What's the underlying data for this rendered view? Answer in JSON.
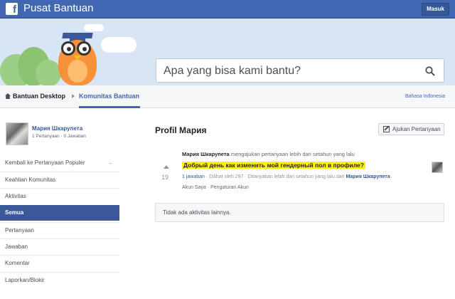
{
  "header": {
    "brand": "Pusat Bantuan",
    "login_label": "Masuk"
  },
  "search": {
    "placeholder": "Apa yang bisa kami bantu?"
  },
  "nav": {
    "home": "Bantuan Desktop",
    "community": "Komunitas Bantuan",
    "language": "Bahasa Indonesia"
  },
  "profile": {
    "name": "Мария Шкарупета",
    "questions": "1 Pertanyaan",
    "separator": "·",
    "answers": "0 Jawaban"
  },
  "sidebar": {
    "items": [
      {
        "label": "Kembali ke Pertanyaan Populer"
      },
      {
        "label": "Keahlian Komunitas"
      },
      {
        "label": "Aktivitas"
      },
      {
        "label": "Semua"
      },
      {
        "label": "Pertanyaan"
      },
      {
        "label": "Jawaban"
      },
      {
        "label": "Komentar"
      },
      {
        "label": "Laporkan/Blokir"
      }
    ]
  },
  "main": {
    "title": "Profil Мария",
    "ask_button": "Ajukan Pertanyaan",
    "activity_user": "Мария Шкарупета",
    "activity_text": "mengajukan pertanyaan lebih dari setahun yang lalu",
    "question": {
      "votes": "19",
      "title": "Добрый день как изменить мой гендерный пол в профиле?",
      "answers": "1 jawaban",
      "views": "Dilihat oleh 297",
      "asked": "Ditanyakan lebih dari setahun yang lalu dari",
      "asker": "Мария Шкарупета",
      "sep": "·",
      "tag1": "Akun Saya",
      "tag2": "Pengaturan Akun"
    },
    "empty_text": "Tidak ada aktivitas lainnya."
  },
  "colors": {
    "brand": "#4267b2",
    "highlight": "#fff200",
    "active_menu": "#3b5998"
  }
}
